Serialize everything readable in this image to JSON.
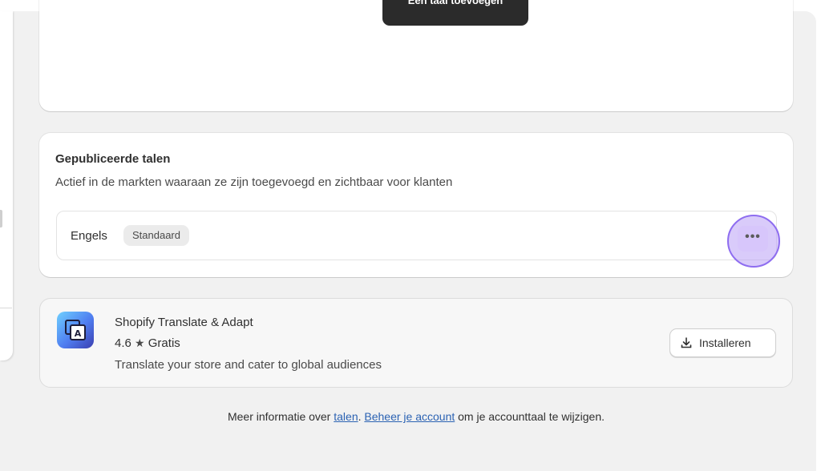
{
  "top_card": {
    "add_language_label": "Een taal toevoegen"
  },
  "published": {
    "title": "Gepubliceerde talen",
    "subtitle": "Actief in de markten waaraan ze zijn toegevoegd en zichtbaar voor klanten",
    "languages": [
      {
        "name": "Engels",
        "badge": "Standaard",
        "menu_label": "•••"
      }
    ]
  },
  "app": {
    "name": "Shopify Translate & Adapt",
    "rating": "4.6",
    "price": "Gratis",
    "description": "Translate your store and cater to global audiences",
    "install_label": "Installeren",
    "icon": "translate-app-icon"
  },
  "footer": {
    "prefix": "Meer informatie over ",
    "link_languages": "talen",
    "separator": ". ",
    "link_account": "Beheer je account",
    "suffix": " om je accounttaal te wijzigen."
  },
  "colors": {
    "background": "#f1f1f1",
    "card": "#ffffff",
    "highlight_ring": "#8e6df0",
    "link": "#2b62b3",
    "dark_button": "#2b2b2b"
  }
}
